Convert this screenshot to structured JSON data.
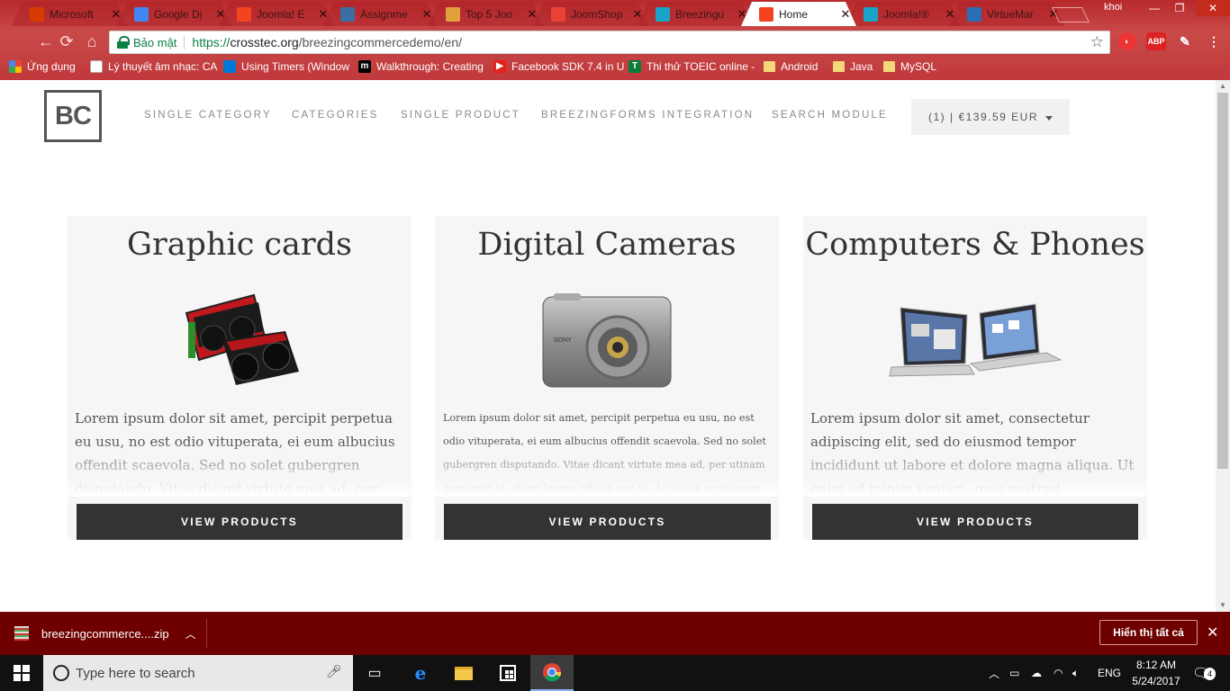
{
  "browser": {
    "tabs": [
      {
        "title": "Microsoft",
        "fav": "windows-icon",
        "color": "#d83b01"
      },
      {
        "title": "Google Dị",
        "fav": "google-translate-icon",
        "color": "#4285f4"
      },
      {
        "title": "Joomla! E",
        "fav": "joomla-icon",
        "color": "#f44321"
      },
      {
        "title": "Assignme",
        "fav": "assignment-icon",
        "color": "#3a6ea5"
      },
      {
        "title": "Top 5 Joo",
        "fav": "bookmark-icon",
        "color": "#e2a03f"
      },
      {
        "title": "JoomShop",
        "fav": "google-icon",
        "color": "#ea4335"
      },
      {
        "title": "Breezingu",
        "fav": "crosstec-icon",
        "color": "#1aa3c9"
      },
      {
        "title": "Home",
        "fav": "joomla-icon",
        "color": "#f44321",
        "active": true
      },
      {
        "title": "Joomla!®",
        "fav": "crosstec-icon",
        "color": "#1aa3c9"
      },
      {
        "title": "VirtueMar",
        "fav": "virtuemart-icon",
        "color": "#2a6fb5"
      }
    ],
    "profile_name": "khoi",
    "security_label": "Bảo mật",
    "url_scheme": "https://",
    "url_host": "crosstec.org",
    "url_path": "/breezingcommercedemo/en/",
    "bookmarks": [
      {
        "label": "Ứng dụng",
        "icon": "apps-icon"
      },
      {
        "label": "Lý thuyết âm nhạc: CA",
        "icon": "page-icon"
      },
      {
        "label": "Using Timers (Window",
        "icon": "windows-icon"
      },
      {
        "label": "Walkthrough: Creating",
        "icon": "medium-icon"
      },
      {
        "label": "Facebook SDK 7.4 in U",
        "icon": "youtube-icon"
      },
      {
        "label": "Thi thử TOEIC online -",
        "icon": "toeic-icon"
      },
      {
        "label": "Android",
        "icon": "folder-icon"
      },
      {
        "label": "Java",
        "icon": "folder-icon"
      },
      {
        "label": "MySQL",
        "icon": "folder-icon"
      }
    ]
  },
  "site": {
    "logo_text": "BC",
    "nav": [
      "SINGLE CATEGORY",
      "CATEGORIES",
      "SINGLE PRODUCT",
      "BREEZINGFORMS INTEGRATION",
      "SEARCH MODULE"
    ],
    "cart_label": "(1) | €139.59 EUR",
    "categories": [
      {
        "title": "Graphic cards",
        "description": "Lorem ipsum dolor sit amet, percipit perpetua eu usu, no est odio vituperata, ei eum albucius offendit scaevola. Sed no solet gubergren disputando. Vitae dicant virtute mea ad, per",
        "button": "VIEW PRODUCTS"
      },
      {
        "title": "Digital Cameras",
        "description": "Lorem ipsum dolor sit amet, percipit perpetua eu usu, no est odio vituperata, ei eum albucius offendit scaevola. Sed no solet gubergren disputando. Vitae dicant virtute mea ad, per utinam menandri te, etiam legere officiis quo te. Accusata scriptorem at",
        "button": "VIEW PRODUCTS"
      },
      {
        "title": "Computers & Phones",
        "description": "Lorem ipsum dolor sit amet, consectetur adipiscing elit, sed do eiusmod tempor incididunt ut labore et dolore magna aliqua. Ut enim ad minim veniam, quis nostrud exercitation ullamco laboris nisi ut",
        "button": "VIEW PRODUCTS"
      }
    ]
  },
  "download_shelf": {
    "filename": "breezingcommerce....zip",
    "show_all": "Hiển thị tất cả"
  },
  "taskbar": {
    "search_placeholder": "Type here to search",
    "language": "ENG",
    "time": "8:12 AM",
    "date": "5/24/2017",
    "notification_count": "4"
  }
}
